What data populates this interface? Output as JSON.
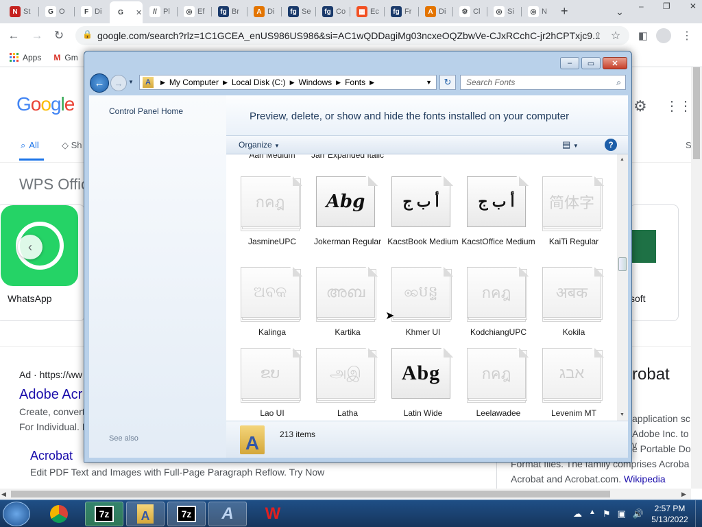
{
  "browser": {
    "tabs": [
      {
        "fav_color": "#c5221f",
        "fav_letter": "N",
        "label": "St"
      },
      {
        "fav_color": "#ffffff",
        "fav_letter": "G",
        "label": "O"
      },
      {
        "fav_color": "#ffffff",
        "fav_letter": "F",
        "label": "Di"
      },
      {
        "fav_color": "#ffffff",
        "fav_letter": "G",
        "label": ""
      },
      {
        "fav_color": "#ffffff",
        "fav_letter": "//",
        "label": "Pl"
      },
      {
        "fav_color": "#ffffff",
        "fav_letter": "◎",
        "label": "Ef"
      },
      {
        "fav_color": "#1a3a6b",
        "fav_letter": "fg",
        "label": "Br"
      },
      {
        "fav_color": "#e37400",
        "fav_letter": "A",
        "label": "Di"
      },
      {
        "fav_color": "#1a3a6b",
        "fav_letter": "fg",
        "label": "Se"
      },
      {
        "fav_color": "#1a3a6b",
        "fav_letter": "fg",
        "label": "Co"
      },
      {
        "fav_color": "#f25022",
        "fav_letter": "▦",
        "label": "Ec"
      },
      {
        "fav_color": "#1a3a6b",
        "fav_letter": "fg",
        "label": "Fr"
      },
      {
        "fav_color": "#e37400",
        "fav_letter": "A",
        "label": "Di"
      },
      {
        "fav_color": "#ffffff",
        "fav_letter": "⚙",
        "label": "Cl"
      },
      {
        "fav_color": "#ffffff",
        "fav_letter": "◎",
        "label": "Si"
      },
      {
        "fav_color": "#ffffff",
        "fav_letter": "◎",
        "label": "N"
      }
    ],
    "new_tab": "+",
    "url": "google.com/search?rlz=1C1GCEA_enUS986US986&si=AC1wQDDagiMg03ncxeOQZbwVe-CJxRCchC-jr2hCPTxjc9...",
    "bookmarks": [
      "Apps",
      "Gm"
    ]
  },
  "google": {
    "logo": "Google",
    "tab_all": "All",
    "tab_sh": "Sh",
    "tab_s": "S",
    "wps": "WPS Offic",
    "whatsapp": "WhatsApp",
    "soft": "soft",
    "ad_prefix": "Ad · https://ww",
    "adobe_title": "Adobe Acr",
    "create_line": "Create, convert",
    "for_line": "For Individual. F",
    "acrobat_link": "Acrobat",
    "acrobat_desc": "Edit PDF Text and Images with Full-Page Paragraph Reflow. Try Now",
    "right_title": "robat",
    "right_line1": "application sc",
    "right_line2": "Adobe Inc. to v",
    "right_line3": "e Portable Do",
    "right_line4": "Format files. The family comprises Acroba",
    "right_line5": "Acrobat and Acrobat.com.",
    "wikipedia": "Wikipedia"
  },
  "explorer": {
    "breadcrumb": [
      "My Computer",
      "Local Disk (C:)",
      "Windows",
      "Fonts"
    ],
    "search_placeholder": "Search Fonts",
    "control_panel_home": "Control Panel Home",
    "see_also": "See also",
    "header": "Preview, delete, or show and hide the fonts installed on your computer",
    "organize": "Organize",
    "status_count": "213 items",
    "partial_row": [
      "Aan Medium",
      "Jarr Expanded Italic"
    ],
    "fonts": [
      {
        "name": "JasmineUPC",
        "sample": "กคฎ",
        "active": false,
        "stacked": true
      },
      {
        "name": "Jokerman Regular",
        "sample": "Abg",
        "active": true,
        "stacked": false
      },
      {
        "name": "KacstBook Medium",
        "sample": "أ ب ج",
        "active": true,
        "stacked": false
      },
      {
        "name": "KacstOffice Medium",
        "sample": "أ ب ج",
        "active": true,
        "stacked": false
      },
      {
        "name": "KaiTi Regular",
        "sample": "简体字",
        "active": false,
        "stacked": true
      },
      {
        "name": "Kalinga",
        "sample": "ଅବକ",
        "active": false,
        "stacked": true
      },
      {
        "name": "Kartika",
        "sample": "അബ",
        "active": false,
        "stacked": true
      },
      {
        "name": "Khmer UI",
        "sample": "ꩩបន្ទ",
        "active": false,
        "stacked": true
      },
      {
        "name": "KodchiangUPC",
        "sample": "กคฎ",
        "active": false,
        "stacked": true
      },
      {
        "name": "Kokila",
        "sample": "अबक",
        "active": false,
        "stacked": true
      },
      {
        "name": "Lao UI",
        "sample": "ຂບ",
        "active": false,
        "stacked": true
      },
      {
        "name": "Latha",
        "sample": "அஇ",
        "active": false,
        "stacked": true
      },
      {
        "name": "Latin Wide",
        "sample": "Abg",
        "active": true,
        "stacked": false
      },
      {
        "name": "Leelawadee",
        "sample": "กคฎ",
        "active": false,
        "stacked": true
      },
      {
        "name": "Levenim MT",
        "sample": "אבג",
        "active": false,
        "stacked": true
      }
    ]
  },
  "taskbar": {
    "time": "2:57 PM",
    "date": "5/13/2022",
    "apps": [
      "start",
      "chrome",
      "7-zip",
      "fonts-folder",
      "7-zip",
      "font-viewer",
      "wps-office"
    ]
  }
}
